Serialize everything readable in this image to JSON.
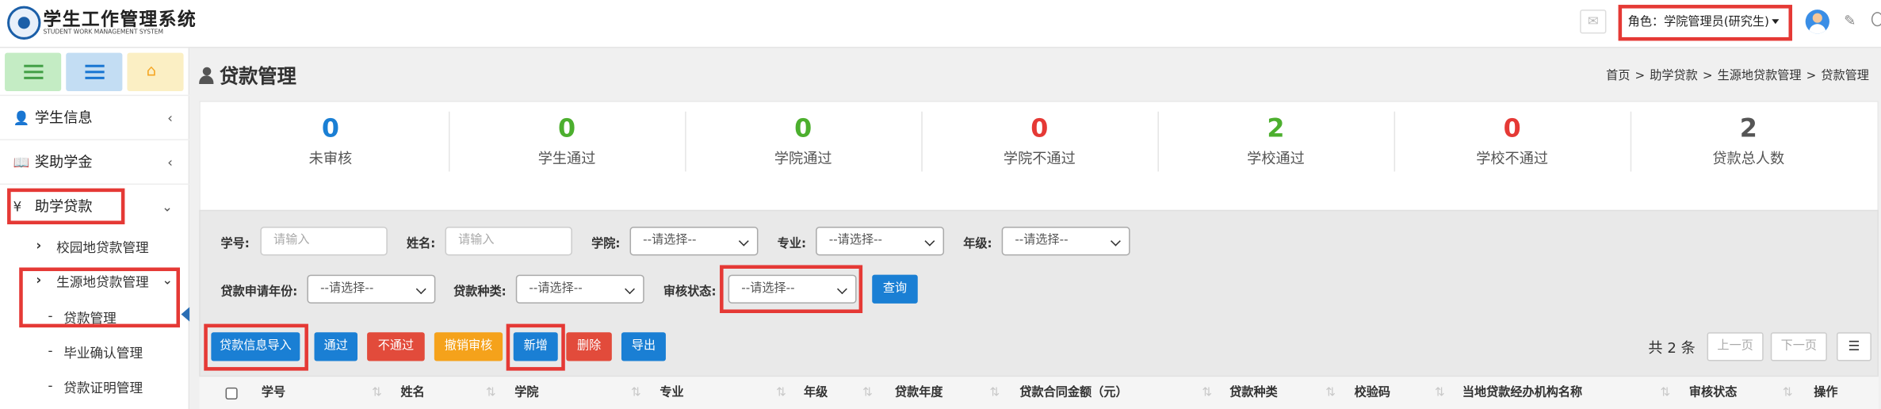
{
  "app": {
    "title": "学生工作管理系统",
    "subtitle": "STUDENT WORK MANAGEMENT SYSTEM",
    "role_label": "角色：学院管理员(研究生)"
  },
  "sidebar": {
    "menus": [
      "学生信息",
      "奖助学金",
      "助学贷款"
    ],
    "sub": [
      "校园地贷款管理",
      "生源地贷款管理"
    ],
    "leaves": [
      "贷款管理",
      "毕业确认管理",
      "贷款证明管理"
    ]
  },
  "page": {
    "title": "贷款管理",
    "breadcrumb": [
      "首页",
      "助学贷款",
      "生源地贷款管理",
      "贷款管理"
    ],
    "sep": ">"
  },
  "stats": [
    {
      "value": "0",
      "label": "未审核",
      "color": "#1a7fd4"
    },
    {
      "value": "0",
      "label": "学生通过",
      "color": "#4caf2e"
    },
    {
      "value": "0",
      "label": "学院通过",
      "color": "#4caf2e"
    },
    {
      "value": "0",
      "label": "学院不通过",
      "color": "#e53935"
    },
    {
      "value": "2",
      "label": "学校通过",
      "color": "#4caf2e"
    },
    {
      "value": "0",
      "label": "学校不通过",
      "color": "#e53935"
    },
    {
      "value": "2",
      "label": "贷款总人数",
      "color": "#555555"
    }
  ],
  "filter": {
    "student_id_label": "学号:",
    "name_label": "姓名:",
    "college_label": "学院:",
    "major_label": "专业:",
    "grade_label": "年级:",
    "year_label": "贷款申请年份:",
    "type_label": "贷款种类:",
    "status_label": "审核状态:",
    "input_placeholder": "请输入",
    "select_placeholder": "--请选择--",
    "query_btn": "查询"
  },
  "actions": {
    "import": "贷款信息导入",
    "pass": "通过",
    "reject": "不通过",
    "revoke": "撤销审核",
    "add": "新增",
    "delete": "删除",
    "export": "导出"
  },
  "pager": {
    "total": "共 2 条",
    "prev": "上一页",
    "next": "下一页"
  },
  "table": {
    "headers": [
      "学号",
      "姓名",
      "学院",
      "专业",
      "年级",
      "贷款年度",
      "贷款合同金额（元）",
      "贷款种类",
      "校验码",
      "当地贷款经办机构名称",
      "审核状态",
      "操作"
    ]
  },
  "colors": {
    "accent": "#1a7fd4",
    "danger": "#e24b3b",
    "warning": "#f5a21b",
    "highlight": "#e53935"
  }
}
